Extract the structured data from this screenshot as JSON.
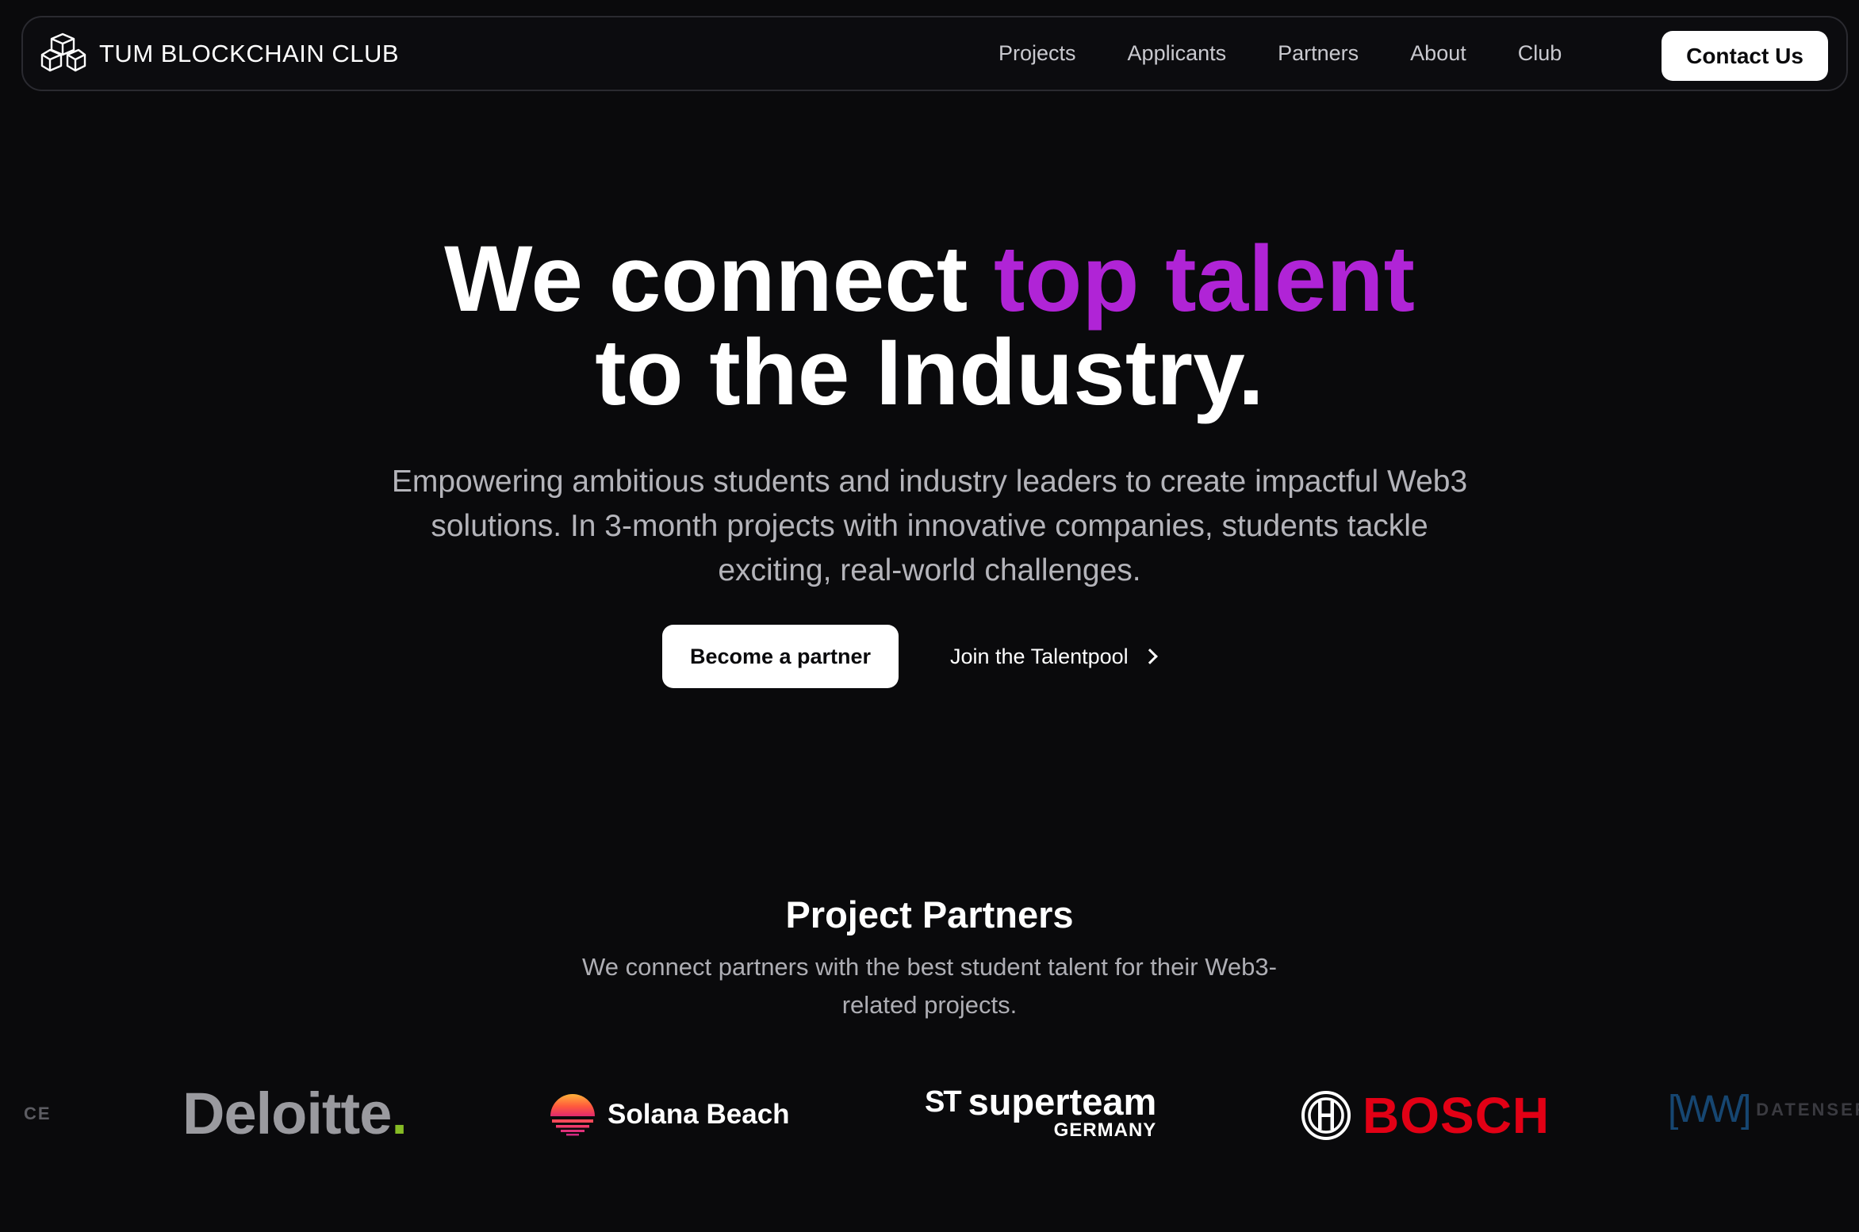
{
  "nav": {
    "brand": "TUM BLOCKCHAIN CLUB",
    "links": [
      "Projects",
      "Applicants",
      "Partners",
      "About",
      "Club"
    ],
    "contact_label": "Contact Us"
  },
  "hero": {
    "title_part1": "We connect ",
    "title_accent": "top talent",
    "title_part2": "to the Industry.",
    "subtitle": "Empowering ambitious students and industry leaders to create impactful Web3 solutions. In 3-month projects with innovative companies, students tackle exciting, real-world challenges.",
    "primary_cta": "Become a partner",
    "secondary_cta": "Join the Talentpool"
  },
  "partners": {
    "title": "Project Partners",
    "subtitle": "We connect partners with the best student talent for their Web3-related projects.",
    "logos": {
      "cut_left": "CE",
      "deloitte": "Deloitte",
      "deloitte_dot": ".",
      "solana": "Solana Beach",
      "superteam_mark": "ST",
      "superteam": "superteam",
      "superteam_sub": "GERMANY",
      "bosch": "BOSCH",
      "ww_mark": "[WW]",
      "ww_text": "DATENSER"
    }
  },
  "colors": {
    "background": "#0a0a0c",
    "accent": "#b024d6",
    "deloitte_green": "#86bc25",
    "bosch_red": "#e20015"
  }
}
